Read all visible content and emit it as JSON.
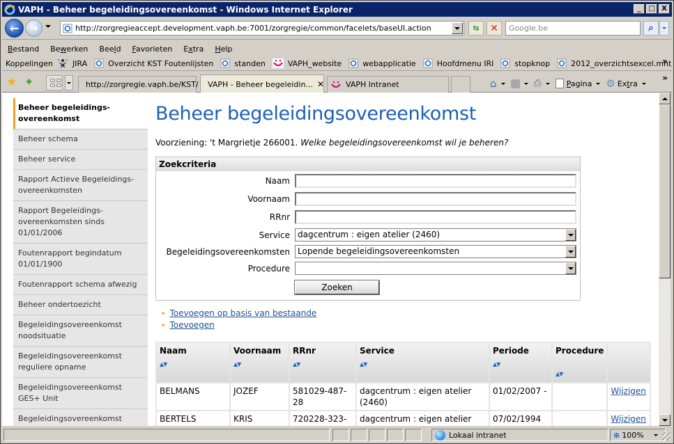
{
  "window": {
    "title": "VAPH - Beheer begeleidingsovereenkomst - Windows Internet Explorer",
    "buttons": [
      "_",
      "□",
      "X"
    ]
  },
  "navbar": {
    "url": "http://zorgregieaccept.development.vaph.be:7001/zorgregie/common/facelets/baseUI.action",
    "search_placeholder": "Google.be",
    "back_icon": "back-arrow-icon",
    "forward_icon": "forward-arrow-icon"
  },
  "menu": {
    "items": [
      {
        "label": "Bestand",
        "accesskey": "B"
      },
      {
        "label": "Bewerken",
        "accesskey": "w"
      },
      {
        "label": "Beeld",
        "accesskey": "l"
      },
      {
        "label": "Favorieten",
        "accesskey": "F"
      },
      {
        "label": "Extra",
        "accesskey": "t"
      },
      {
        "label": "Help",
        "accesskey": "H"
      }
    ]
  },
  "links": {
    "label": "Koppelingen",
    "items": [
      {
        "label": "JIRA",
        "icon": "jira-icon"
      },
      {
        "label": "Overzicht KST Foutenlijsten",
        "icon": "ie-page-icon"
      },
      {
        "label": "standen",
        "icon": "ie-page-icon"
      },
      {
        "label": "VAPH_website",
        "icon": "vaph-icon"
      },
      {
        "label": "webapplicatie",
        "icon": "ie-page-icon"
      },
      {
        "label": "Hoofdmenu IRI",
        "icon": "ie-page-icon"
      },
      {
        "label": "stopknop",
        "icon": "ie-page-icon"
      },
      {
        "label": "2012_overzichtsexcel.mht",
        "icon": "ie-page-icon"
      }
    ]
  },
  "tabs": [
    {
      "label": "http://zorgregie.vaph.be/KST/",
      "icon": "ie-icon",
      "active": false
    },
    {
      "label": "VAPH - Beheer begeleidin...",
      "icon": "ie-icon",
      "active": true,
      "close": "✕"
    },
    {
      "label": "VAPH Intranet",
      "icon": "vaph-icon",
      "active": false
    }
  ],
  "toolbar": {
    "pagina_label": "Pagina",
    "extra_label": "Extra"
  },
  "sidebar": {
    "items": [
      {
        "label": "Beheer begeleidings-overeenkomst",
        "active": true
      },
      {
        "label": "Beheer schema"
      },
      {
        "label": "Beheer service"
      },
      {
        "label": "Rapport Actieve Begeleidings-overeenkomsten"
      },
      {
        "label": "Rapport Begeleidings-overeenkomsten sinds 01/01/2006"
      },
      {
        "label": "Foutenrapport begindatum 01/01/1900"
      },
      {
        "label": "Foutenrapport schema afwezig"
      },
      {
        "label": "Beheer ondertoezicht"
      },
      {
        "label": "Begeleidingsovereenkomst noodsituatie"
      },
      {
        "label": "Begeleidingsovereenkomst reguliere opname"
      },
      {
        "label": "Begeleidingsovereenkomst GES+ Unit"
      },
      {
        "label": "Begeleidingsovereenkomst trajectbegeleiding / jeugdhulp"
      }
    ]
  },
  "main": {
    "title": "Beheer begeleidingsovereenkomst",
    "intro_prefix": "Voorziening: 't Margrietje 266001. ",
    "intro_question": "Welke begeleidingsovereenkomst wil je beheren?",
    "search_panel": {
      "header": "Zoekcriteria",
      "fields": {
        "naam": {
          "label": "Naam",
          "value": ""
        },
        "voornaam": {
          "label": "Voornaam",
          "value": ""
        },
        "rrnr": {
          "label": "RRnr",
          "value": ""
        },
        "service": {
          "label": "Service",
          "value": "dagcentrum : eigen atelier (2460)"
        },
        "begeleidingsovereenkomsten": {
          "label": "Begeleidingsovereenkomsten",
          "value": "Lopende begeleidingsovereenkomsten"
        },
        "procedure": {
          "label": "Procedure",
          "value": ""
        }
      },
      "submit_label": "Zoeken"
    },
    "actions": [
      {
        "label": "Toevoegen op basis van bestaande"
      },
      {
        "label": "Toevoegen"
      }
    ],
    "table": {
      "columns": [
        "Naam",
        "Voornaam",
        "RRnr",
        "Service",
        "Periode",
        "Procedure",
        ""
      ],
      "sort_glyph": "▲▼",
      "rows": [
        {
          "naam": "BELMANS",
          "voornaam": "JOZEF",
          "rrnr": "581029-487-28",
          "service": "dagcentrum : eigen atelier (2460)",
          "periode": "01/02/2007 -",
          "procedure": "",
          "action": "Wijzigen"
        },
        {
          "naam": "BERTELS",
          "voornaam": "KRIS",
          "rrnr": "720228-323-",
          "service": "dagcentrum : eigen atelier",
          "periode": "07/02/1994",
          "procedure": "",
          "action": "Wijzigen"
        }
      ]
    }
  },
  "statusbar": {
    "zone": "Lokaal intranet",
    "zoom": "100%"
  }
}
